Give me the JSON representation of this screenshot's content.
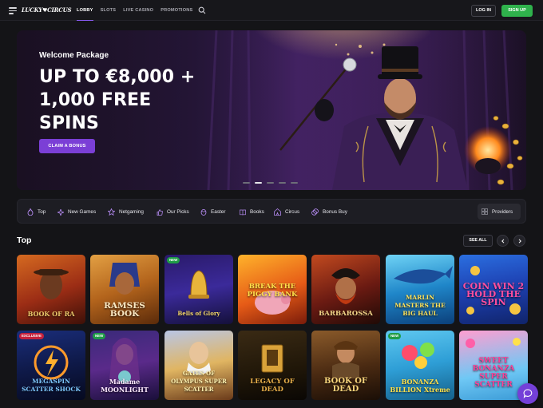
{
  "header": {
    "logo_text": "LUCKY♥CIRCUS",
    "nav": [
      "LOBBY",
      "SLOTS",
      "LIVE CASINO",
      "PROMOTIONS"
    ],
    "login_label": "LOG IN",
    "signup_label": "SIGN UP"
  },
  "hero": {
    "subtitle": "Welcome Package",
    "title_line1": "UP TO €8,000 +",
    "title_line2": "1,000 FREE",
    "title_line3": "SPINS",
    "cta_label": "CLAIM A BONUS",
    "slides_total": 5,
    "active_slide": 1
  },
  "categories": [
    {
      "label": "Top",
      "icon": "flame-icon"
    },
    {
      "label": "New Games",
      "icon": "sparkle-icon"
    },
    {
      "label": "Netgaming",
      "icon": "star-icon"
    },
    {
      "label": "Our Picks",
      "icon": "thumbs-up-icon"
    },
    {
      "label": "Easter",
      "icon": "egg-icon"
    },
    {
      "label": "Books",
      "icon": "book-icon"
    },
    {
      "label": "Circus",
      "icon": "tent-icon"
    },
    {
      "label": "Bonus Buy",
      "icon": "coins-icon"
    }
  ],
  "providers_label": "Providers",
  "section": {
    "title": "Top",
    "see_all_label": "SEE ALL"
  },
  "games_row1": [
    {
      "name": "BOOK OF RA",
      "badge": ""
    },
    {
      "name": "RAMSES BOOK",
      "badge": ""
    },
    {
      "name": "Bells of Glory",
      "badge": "NEW"
    },
    {
      "name": "BREAK THE PIGGY BANK",
      "badge": ""
    },
    {
      "name": "BARBAROSSA",
      "badge": ""
    },
    {
      "name": "MARLIN MASTERS THE BIG HAUL",
      "badge": ""
    },
    {
      "name": "COIN WIN 2 HOLD THE SPIN",
      "badge": ""
    }
  ],
  "games_row2": [
    {
      "name": "MEGASPIN SCATTER SHOCK",
      "badge": "EXCLUSIVE"
    },
    {
      "name": "Madame MOONLIGHT",
      "badge": "NEW"
    },
    {
      "name": "GATES OF OLYMPUS SUPER SCATTER",
      "badge": ""
    },
    {
      "name": "LEGACY OF DEAD",
      "badge": ""
    },
    {
      "name": "BOOK OF DEAD",
      "badge": ""
    },
    {
      "name": "BONANZA BILLION Xtreme",
      "badge": "NEW"
    },
    {
      "name": "SWEET BONANZA SUPER SCATTER",
      "badge": ""
    }
  ],
  "colors": {
    "accent": "#7b3fd6",
    "signup": "#2fb24c",
    "background": "#141417",
    "new_badge": "#1f9c47",
    "exclusive_badge": "#c4203c"
  }
}
